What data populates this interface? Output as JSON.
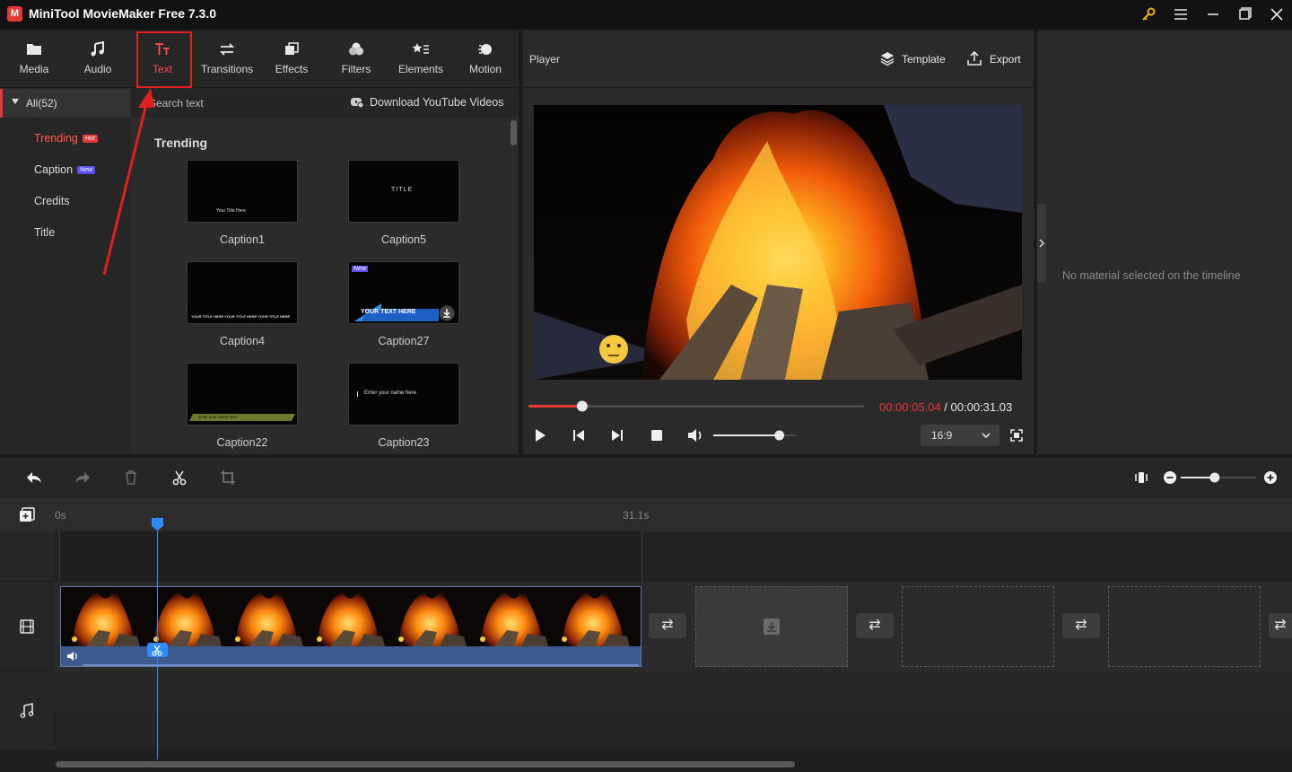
{
  "window": {
    "title": "MiniTool MovieMaker Free 7.3.0",
    "logo_letter": "M"
  },
  "toolbar": {
    "items": [
      {
        "label": "Media",
        "icon": "folder-icon"
      },
      {
        "label": "Audio",
        "icon": "music-note-icon"
      },
      {
        "label": "Text",
        "icon": "text-icon"
      },
      {
        "label": "Transitions",
        "icon": "transitions-icon"
      },
      {
        "label": "Effects",
        "icon": "effects-icon"
      },
      {
        "label": "Filters",
        "icon": "filters-icon"
      },
      {
        "label": "Elements",
        "icon": "elements-icon"
      },
      {
        "label": "Motion",
        "icon": "motion-icon"
      }
    ],
    "active": "Text"
  },
  "categories": {
    "all_label": "All(52)",
    "items": [
      {
        "label": "Trending",
        "badge": "Hot",
        "badge_color": "#e53935"
      },
      {
        "label": "Caption",
        "badge": "New",
        "badge_color": "#5b4ff0"
      },
      {
        "label": "Credits",
        "badge": ""
      },
      {
        "label": "Title",
        "badge": ""
      }
    ]
  },
  "search": {
    "placeholder": "Search text",
    "download_label": "Download YouTube Videos"
  },
  "library": {
    "section_title": "Trending",
    "items": [
      {
        "name": "Caption1",
        "preview_text": "Your   Title Here"
      },
      {
        "name": "Caption5",
        "preview_text": "TITLE"
      },
      {
        "name": "Caption4",
        "preview_text": "YOUR TITLE HERE YOUR TITLE HERE YOUR TITLE HERE"
      },
      {
        "name": "Caption27",
        "preview_text": "YOUR TEXT HERE",
        "badge": "New"
      },
      {
        "name": "Caption22",
        "preview_text": "Enter your name here"
      },
      {
        "name": "Caption23",
        "preview_text": "Enter your name here"
      }
    ]
  },
  "player": {
    "title": "Player",
    "template_label": "Template",
    "export_label": "Export",
    "current_time": "00:00:05.04",
    "separator": " / ",
    "total_time": "00:00:31.03",
    "progress": 0.16,
    "volume": 0.8,
    "aspect_ratio": "16:9"
  },
  "properties": {
    "empty_message": "No material selected on the timeline"
  },
  "timeline": {
    "ruler_start": "0s",
    "ruler_end": "31.1s",
    "zoom_level": 0.45,
    "playhead_fraction": 0.17
  },
  "colors": {
    "accent": "#e53935",
    "playhead": "#2f8cff",
    "clip_bar": "#3c5a8c"
  }
}
